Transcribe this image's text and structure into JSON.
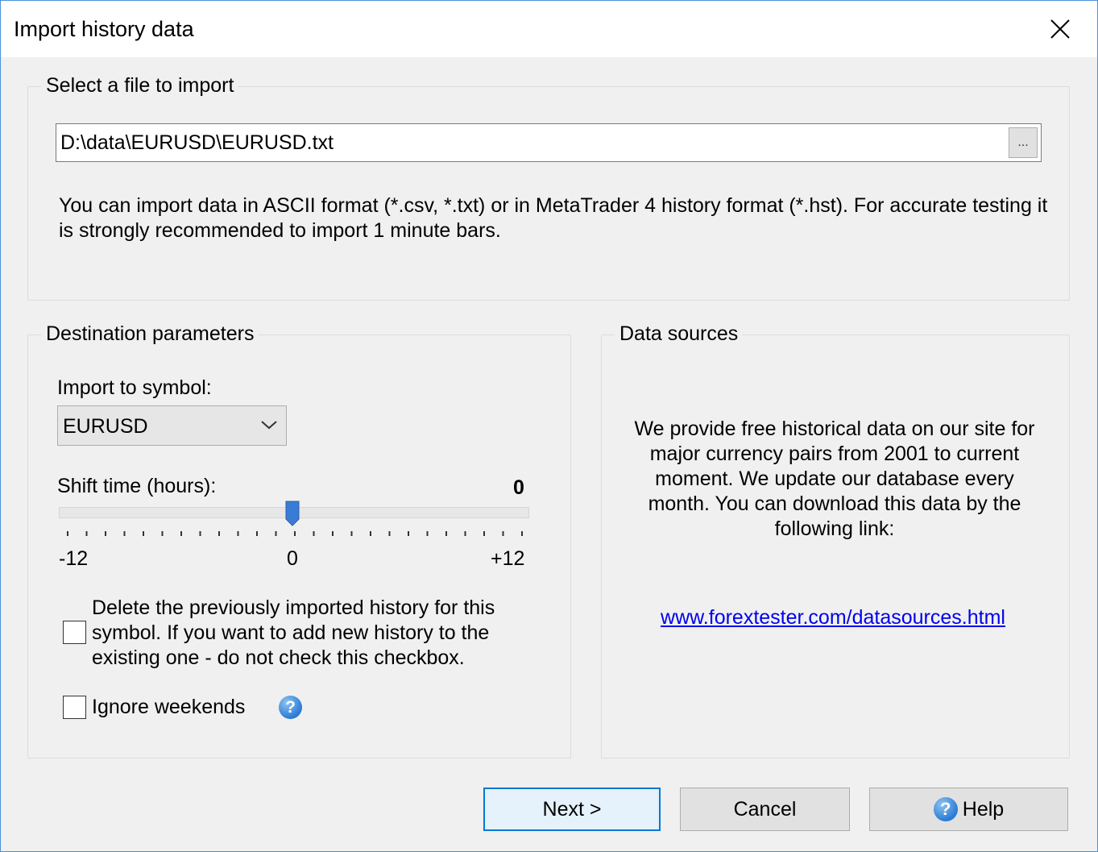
{
  "window": {
    "title": "Import history data"
  },
  "file_group": {
    "label": "Select a file to import",
    "path_value": "D:\\data\\EURUSD\\EURUSD.txt",
    "browse_label": "...",
    "info_text": "You can import data in ASCII format (*.csv, *.txt) or in MetaTrader 4 history format (*.hst). For accurate testing it is strongly recommended to import 1 minute bars."
  },
  "destination": {
    "label": "Destination parameters",
    "symbol_label": "Import to symbol:",
    "symbol_value": "EURUSD",
    "shift_label": "Shift time (hours):",
    "shift_value": "0",
    "shift_min": "-12",
    "shift_mid": "0",
    "shift_max": "+12",
    "delete_history_text": "Delete the previously imported history for this symbol. If you want to add new history to the existing one - do not check this  checkbox.",
    "delete_history_checked": false,
    "ignore_weekends_label": "Ignore weekends",
    "ignore_weekends_checked": false,
    "help_icon": "question-icon"
  },
  "data_sources": {
    "label": "Data sources",
    "text": "We provide free historical data on our site for major currency pairs from 2001 to current moment. We update our database every month. You can download this data by the following link:",
    "link": "www.forextester.com/datasources.html"
  },
  "buttons": {
    "next": "Next >",
    "cancel": "Cancel",
    "help": "Help"
  },
  "colors": {
    "accent": "#0078d7",
    "link": "#0000ee",
    "slider_thumb": "#3a7bd5"
  }
}
